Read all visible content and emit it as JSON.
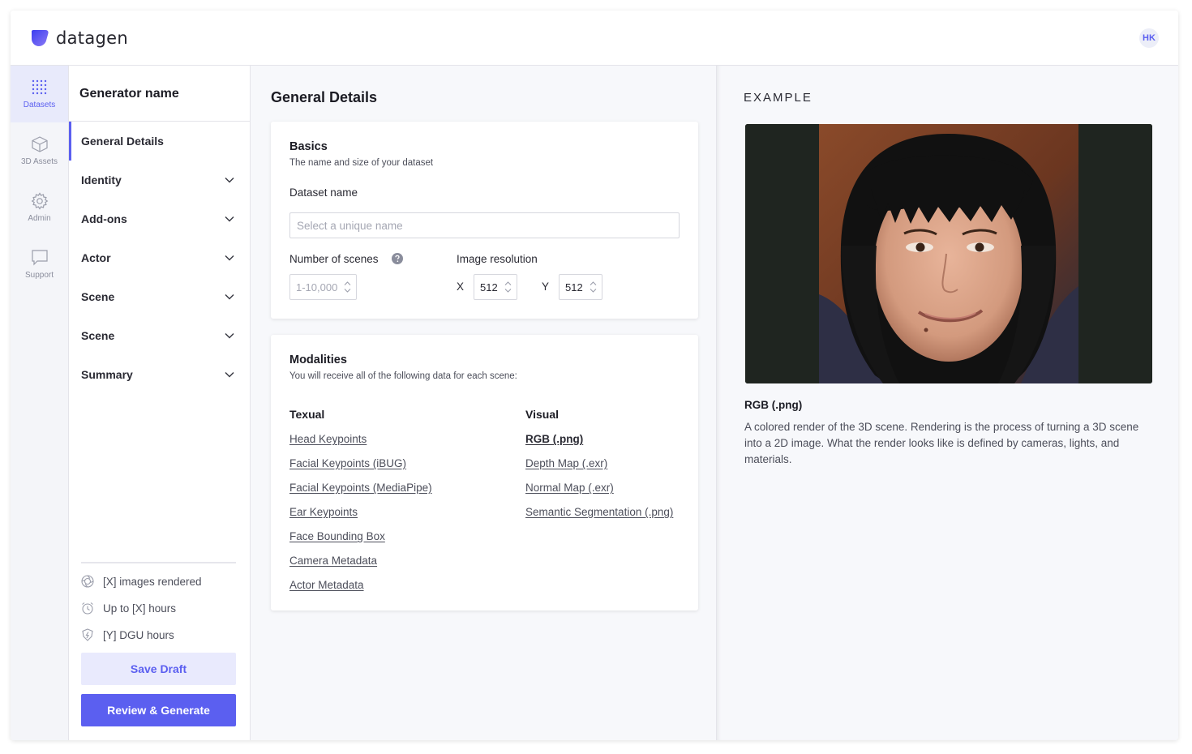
{
  "app": {
    "logo_text": "datagen",
    "user_initials": "HK"
  },
  "rail": {
    "items": [
      {
        "label": "Datasets",
        "icon": "grid-icon",
        "active": true
      },
      {
        "label": "3D Assets",
        "icon": "cube-icon"
      },
      {
        "label": "Admin",
        "icon": "gear-icon"
      },
      {
        "label": "Support",
        "icon": "chat-icon"
      }
    ]
  },
  "stepper": {
    "generator_name": "Generator name",
    "steps": [
      {
        "label": "General Details",
        "active": true
      },
      {
        "label": "Identity"
      },
      {
        "label": "Add-ons"
      },
      {
        "label": "Actor"
      },
      {
        "label": "Scene"
      },
      {
        "label": "Scene"
      },
      {
        "label": "Summary"
      }
    ],
    "stats": [
      {
        "text": "[X] images rendered",
        "icon": "aperture-icon"
      },
      {
        "text": "Up to [X] hours",
        "icon": "alarm-clock-icon"
      },
      {
        "text": "[Y] DGU hours",
        "icon": "shield-bolt-icon"
      }
    ],
    "save_draft": "Save Draft",
    "review_generate": "Review & Generate"
  },
  "main": {
    "title": "General Details",
    "basics": {
      "title": "Basics",
      "subtitle": "The name and size of your dataset",
      "dataset_name_label": "Dataset name",
      "dataset_name_placeholder": "Select a unique name",
      "scenes_label": "Number of scenes",
      "scenes_placeholder": "1-10,000",
      "resolution_label": "Image resolution",
      "x_label": "X",
      "x_value": "512",
      "y_label": "Y",
      "y_value": "512"
    },
    "modalities": {
      "title": "Modalities",
      "subtitle": "You will receive all of the following data for each scene:",
      "textual_heading": "Texual",
      "textual": [
        "Head Keypoints",
        "Facial Keypoints (iBUG)",
        "Facial Keypoints (MediaPipe)",
        "Ear Keypoints",
        "Face Bounding Box",
        "Camera Metadata",
        "Actor Metadata"
      ],
      "visual_heading": "Visual",
      "visual": [
        "RGB (.png)",
        "Depth Map (.exr)",
        "Normal Map (.exr)",
        "Semantic Segmentation (.png)"
      ]
    }
  },
  "example": {
    "heading": "EXAMPLE",
    "title": "RGB (.png)",
    "description": "A colored render of the 3D scene. Rendering is the process of turning a 3D scene into a 2D image. What the render looks like is defined by cameras, lights, and materials.",
    "colors": {
      "accent": "#5b5ff0",
      "accent_light": "#e9eafd"
    }
  }
}
